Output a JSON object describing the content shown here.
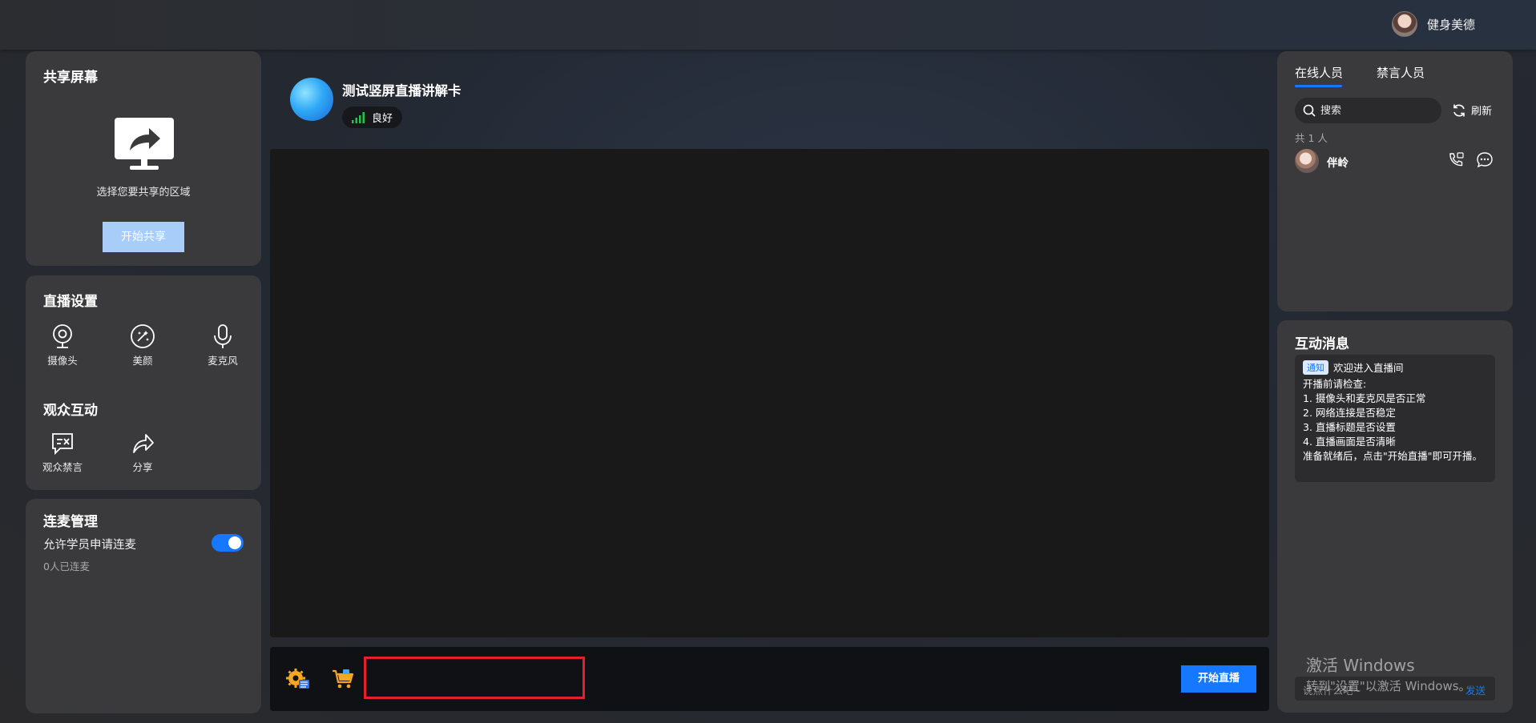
{
  "header": {
    "user_name": "健身美德"
  },
  "share_panel": {
    "title": "共享屏幕",
    "tip": "选择您要共享的区域",
    "button": "开始共享"
  },
  "settings_panel": {
    "title": "直播设置",
    "tools": [
      {
        "label": "摄像头",
        "icon": "camera-icon"
      },
      {
        "label": "美颜",
        "icon": "beauty-icon"
      },
      {
        "label": "麦克风",
        "icon": "microphone-icon"
      }
    ],
    "audience_title": "观众互动",
    "audience_tools": [
      {
        "label": "观众禁言",
        "icon": "mute-audience-icon"
      },
      {
        "label": "分享",
        "icon": "share-icon"
      }
    ]
  },
  "linkmic_panel": {
    "title": "连麦管理",
    "allow_label": "允许学员申请连麦",
    "allow_enabled": true,
    "linked_count": "0人已连麦"
  },
  "room": {
    "title": "测试竖屏直播讲解卡",
    "network_status": "良好"
  },
  "bottom_bar": {
    "start_live": "开始直播"
  },
  "online_panel": {
    "tabs": [
      "在线人员",
      "禁言人员"
    ],
    "active_tab": "在线人员",
    "search_placeholder": "搜索",
    "refresh": "刷新",
    "count": "共 1 人",
    "members": [
      {
        "name": "伴岭"
      }
    ]
  },
  "messages_panel": {
    "title": "互动消息",
    "notice_tag": "通知",
    "notice_text": "欢迎进入直播间",
    "lines": [
      "开播前请检查:",
      "1. 摄像头和麦克风是否正常",
      "2. 网络连接是否稳定",
      "3. 直播标题是否设置",
      "4. 直播画面是否清晰",
      "准备就绪后，点击\"开始直播\"即可开播。"
    ],
    "input_placeholder": "说点什么吧~",
    "send": "发送"
  },
  "watermark": {
    "title": "激活 Windows",
    "subtitle": "转到\"设置\"以激活 Windows。"
  },
  "colors": {
    "accent": "#1677ff",
    "highlight_border": "#e2212b",
    "panel": "#3a3a3c"
  }
}
